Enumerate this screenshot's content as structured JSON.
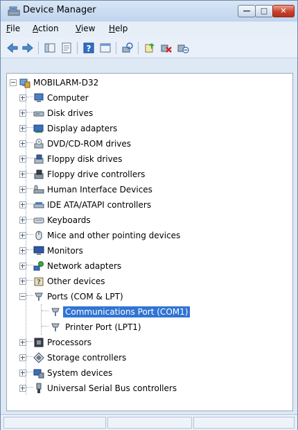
{
  "window": {
    "title": "Device Manager"
  },
  "menu": [
    {
      "label": "File",
      "key": "F",
      "rest": "ile"
    },
    {
      "label": "Action",
      "key": "A",
      "rest": "ction"
    },
    {
      "label": "View",
      "key": "V",
      "rest": "iew"
    },
    {
      "label": "Help",
      "key": "H",
      "rest": "elp"
    }
  ],
  "toolbar": {
    "icons": [
      "back-arrow-icon",
      "forward-arrow-icon",
      "show-hide-console-tree-icon",
      "properties-icon",
      "help-icon",
      "view-icon",
      "scan-hardware-icon",
      "update-driver-icon",
      "uninstall-icon",
      "disable-device-icon"
    ]
  },
  "tree": {
    "root": "MOBILARM-D32",
    "items": [
      {
        "label": "Computer",
        "icon": "computer-icon"
      },
      {
        "label": "Disk drives",
        "icon": "disk-drive-icon"
      },
      {
        "label": "Display adapters",
        "icon": "display-adapter-icon"
      },
      {
        "label": "DVD/CD-ROM drives",
        "icon": "dvd-drive-icon"
      },
      {
        "label": "Floppy disk drives",
        "icon": "floppy-disk-icon"
      },
      {
        "label": "Floppy drive controllers",
        "icon": "floppy-controller-icon"
      },
      {
        "label": "Human Interface Devices",
        "icon": "hid-icon"
      },
      {
        "label": "IDE ATA/ATAPI controllers",
        "icon": "ide-controller-icon"
      },
      {
        "label": "Keyboards",
        "icon": "keyboard-icon"
      },
      {
        "label": "Mice and other pointing devices",
        "icon": "mouse-icon"
      },
      {
        "label": "Monitors",
        "icon": "monitor-icon"
      },
      {
        "label": "Network adapters",
        "icon": "network-adapter-icon"
      },
      {
        "label": "Other devices",
        "icon": "other-devices-icon"
      },
      {
        "label": "Ports (COM & LPT)",
        "icon": "port-icon",
        "expanded": true
      },
      {
        "label": "Processors",
        "icon": "processor-icon"
      },
      {
        "label": "Storage controllers",
        "icon": "storage-controller-icon"
      },
      {
        "label": "System devices",
        "icon": "system-devices-icon"
      },
      {
        "label": "Universal Serial Bus controllers",
        "icon": "usb-icon"
      }
    ],
    "ports_children": [
      {
        "label": "Communications Port (COM1)",
        "selected": true
      },
      {
        "label": "Printer Port (LPT1)",
        "selected": false
      }
    ]
  },
  "colors": {
    "selection": "#3174d4",
    "close_button": "#c8412c"
  }
}
